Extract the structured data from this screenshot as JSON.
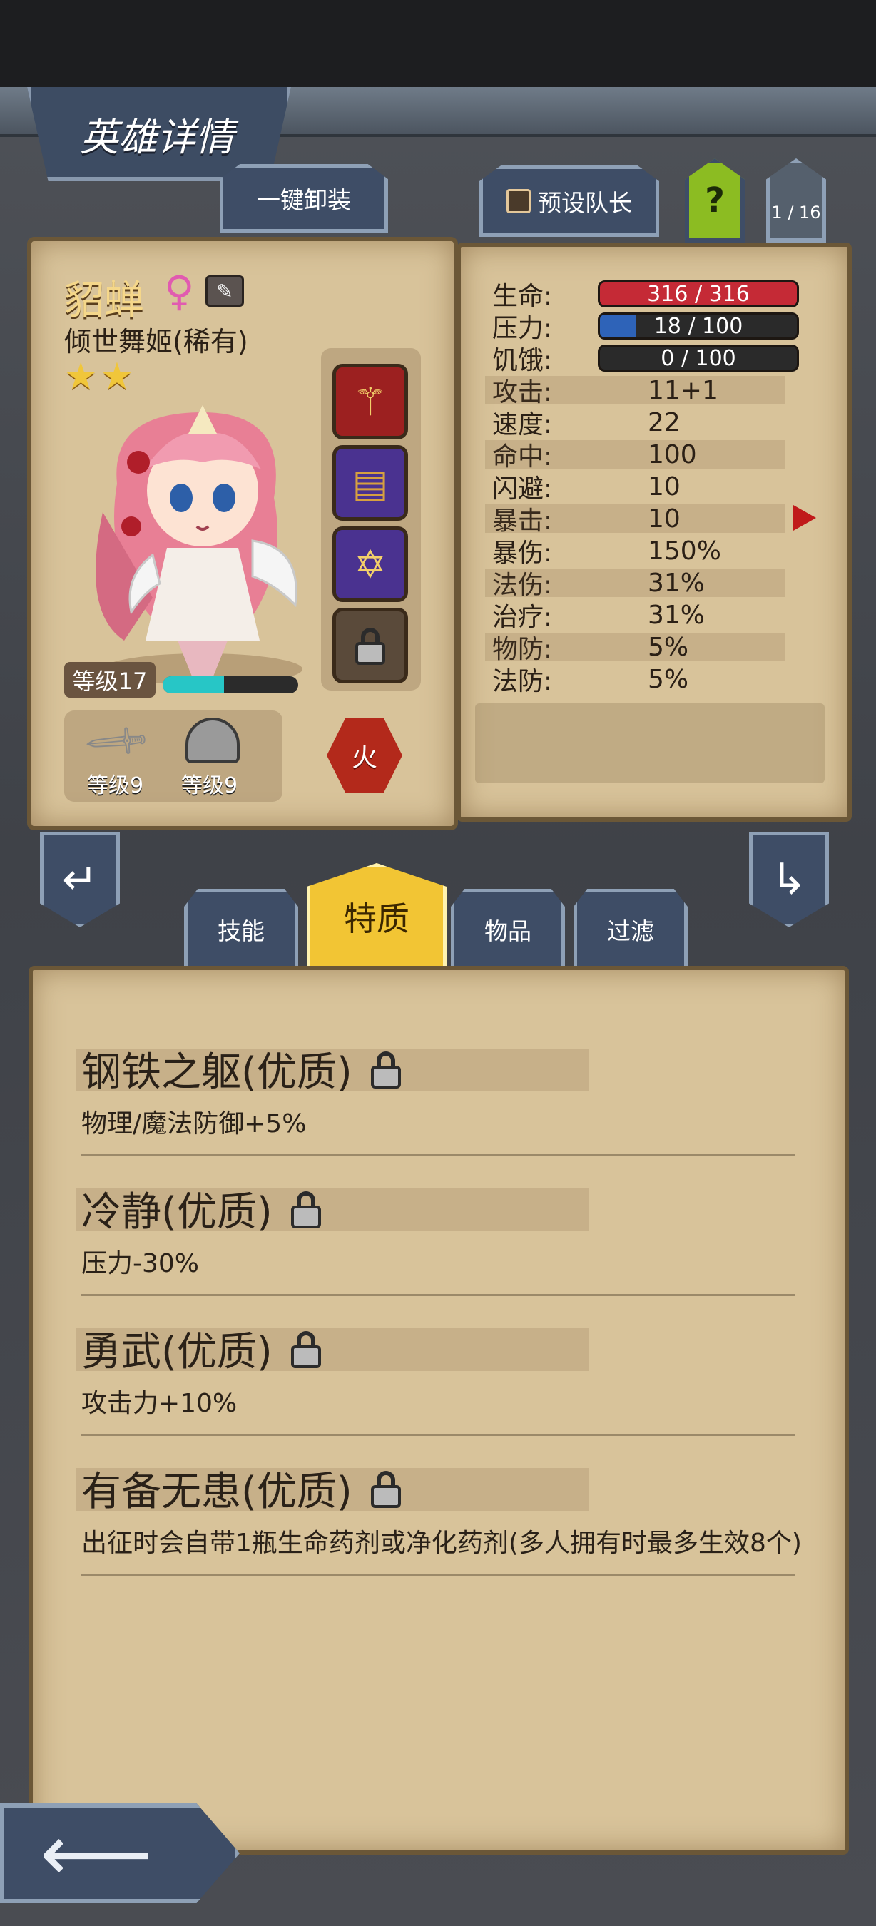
{
  "header": {
    "title": "英雄详情"
  },
  "toolbar": {
    "unequip_all": "一键卸装",
    "preset_leader": "预设队长",
    "help": "?",
    "page_indicator": "1 / 16"
  },
  "hero": {
    "name": "貂蝉",
    "gender_symbol": "♀",
    "title": "倾世舞姬(稀有)",
    "stars": 2,
    "level_label": "等级17",
    "xp_fraction": 0.45,
    "weapon_level": "等级9",
    "armor_level": "等级9",
    "element": "火"
  },
  "stats": [
    {
      "label": "生命:",
      "value": "316 / 316",
      "type": "bar",
      "color": "#c52a36",
      "fraction": 1.0
    },
    {
      "label": "压力:",
      "value": "18 / 100",
      "type": "bar",
      "color": "#2e63b8",
      "fraction": 0.18
    },
    {
      "label": "饥饿:",
      "value": "0 / 100",
      "type": "bar",
      "color": "#3a3a3a",
      "fraction": 0.0
    },
    {
      "label": "攻击:",
      "value": "11+1"
    },
    {
      "label": "速度:",
      "value": "22"
    },
    {
      "label": "命中:",
      "value": "100"
    },
    {
      "label": "闪避:",
      "value": "10"
    },
    {
      "label": "暴击:",
      "value": "10"
    },
    {
      "label": "暴伤:",
      "value": "150%"
    },
    {
      "label": "法伤:",
      "value": "31%"
    },
    {
      "label": "治疗:",
      "value": "31%"
    },
    {
      "label": "物防:",
      "value": "5%"
    },
    {
      "label": "法防:",
      "value": "5%"
    }
  ],
  "tabs": [
    {
      "label": "技能",
      "active": false
    },
    {
      "label": "特质",
      "active": true
    },
    {
      "label": "物品",
      "active": false
    },
    {
      "label": "过滤",
      "active": false
    }
  ],
  "traits": [
    {
      "name": "钢铁之躯(优质)",
      "desc": "物理/魔法防御+5%"
    },
    {
      "name": "冷静(优质)",
      "desc": "压力-30%"
    },
    {
      "name": "勇武(优质)",
      "desc": "攻击力+10%"
    },
    {
      "name": "有备无患(优质)",
      "desc": "出征时会自带1瓶生命药剂或净化药剂(多人拥有时最多生效8个)"
    }
  ],
  "colors": {
    "accent_gold": "#f0c63a",
    "parchment": "#d8c39a",
    "hp": "#c52a36",
    "stress": "#2e63b8"
  }
}
